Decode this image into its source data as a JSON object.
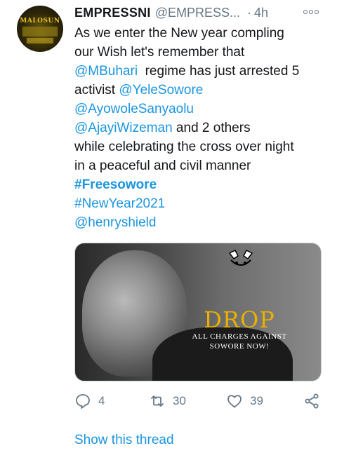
{
  "tweet": {
    "author_name": "EMPRESSNI",
    "author_handle": "@EMPRESS...",
    "dot": "·",
    "time": "4h",
    "avatar_text": "MALOSUN",
    "lines": {
      "l1": "As we enter the New year compling",
      "l2": "our Wish let's remember that",
      "l3_mention": "@MBuhari",
      "l3_rest": "  regime has just arrested 5",
      "l4_text": "activist ",
      "l4_mention": "@YeleSowore",
      "l5_mention": "@AyowoleSanyaolu",
      "l6_mention": "@AjayiWizeman",
      "l6_rest": " and 2 others",
      "l7": "while celebrating the cross over night",
      "l8": "in a peaceful and civil manner",
      "l9_tag": "#Freesowore",
      "l10_tag": "#NewYear2021",
      "l11_mention": "@henryshield"
    },
    "media": {
      "headline": "DROP",
      "subline1": "ALL CHARGES AGAINST",
      "subline2": "SOWORE NOW!"
    },
    "actions": {
      "reply_count": "4",
      "retweet_count": "30",
      "like_count": "39"
    },
    "show_thread": "Show this thread"
  },
  "colors": {
    "link": "#1b95e0",
    "muted": "#657786",
    "text": "#14171a",
    "headline": "#e8b000"
  },
  "icons": [
    "more-icon",
    "reply-icon",
    "retweet-icon",
    "like-icon",
    "share-icon"
  ]
}
